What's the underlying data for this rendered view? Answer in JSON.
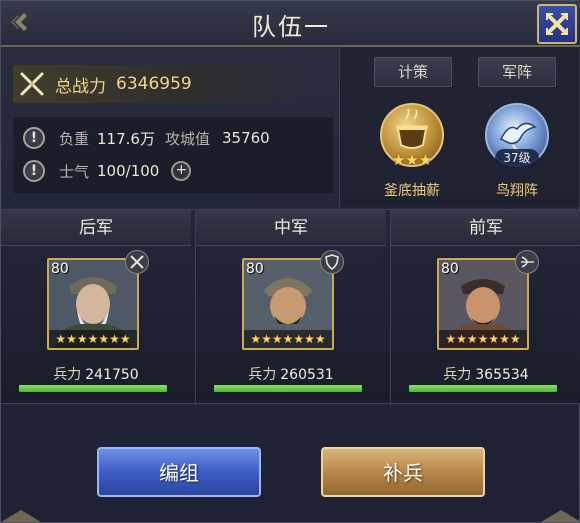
{
  "header": {
    "title": "队伍一"
  },
  "power": {
    "label": "总战力",
    "value": "6346959"
  },
  "stats": {
    "load_label": "负重",
    "load_value": "117.6万",
    "siege_label": "攻城值",
    "siege_value": "35760",
    "morale_label": "士气",
    "morale_value": "100/100",
    "plus": "+"
  },
  "strategy": {
    "tab_label": "计策",
    "name": "釜底抽薪",
    "stars": "★★★"
  },
  "formation": {
    "tab_label": "军阵",
    "name": "鸟翔阵",
    "level": "37级"
  },
  "troops": [
    {
      "position": "后军",
      "level": "80",
      "stars": "★★★★★★★",
      "count_label": "兵力",
      "count": "241750",
      "hp_fraction": 1.0,
      "type_icon": "crossed-swords-icon"
    },
    {
      "position": "中军",
      "level": "80",
      "stars": "★★★★★★★",
      "count_label": "兵力",
      "count": "260531",
      "hp_fraction": 1.0,
      "type_icon": "shield-icon"
    },
    {
      "position": "前军",
      "level": "80",
      "stars": "★★★★★★★",
      "count_label": "兵力",
      "count": "365534",
      "hp_fraction": 1.0,
      "type_icon": "bow-icon"
    }
  ],
  "buttons": {
    "edit": "编组",
    "replenish": "补兵"
  },
  "colors": {
    "gold": "#f3d58a",
    "hp_green": "#6fd14e",
    "blue_button": "#3d5ec3",
    "gold_button": "#b8874a"
  }
}
